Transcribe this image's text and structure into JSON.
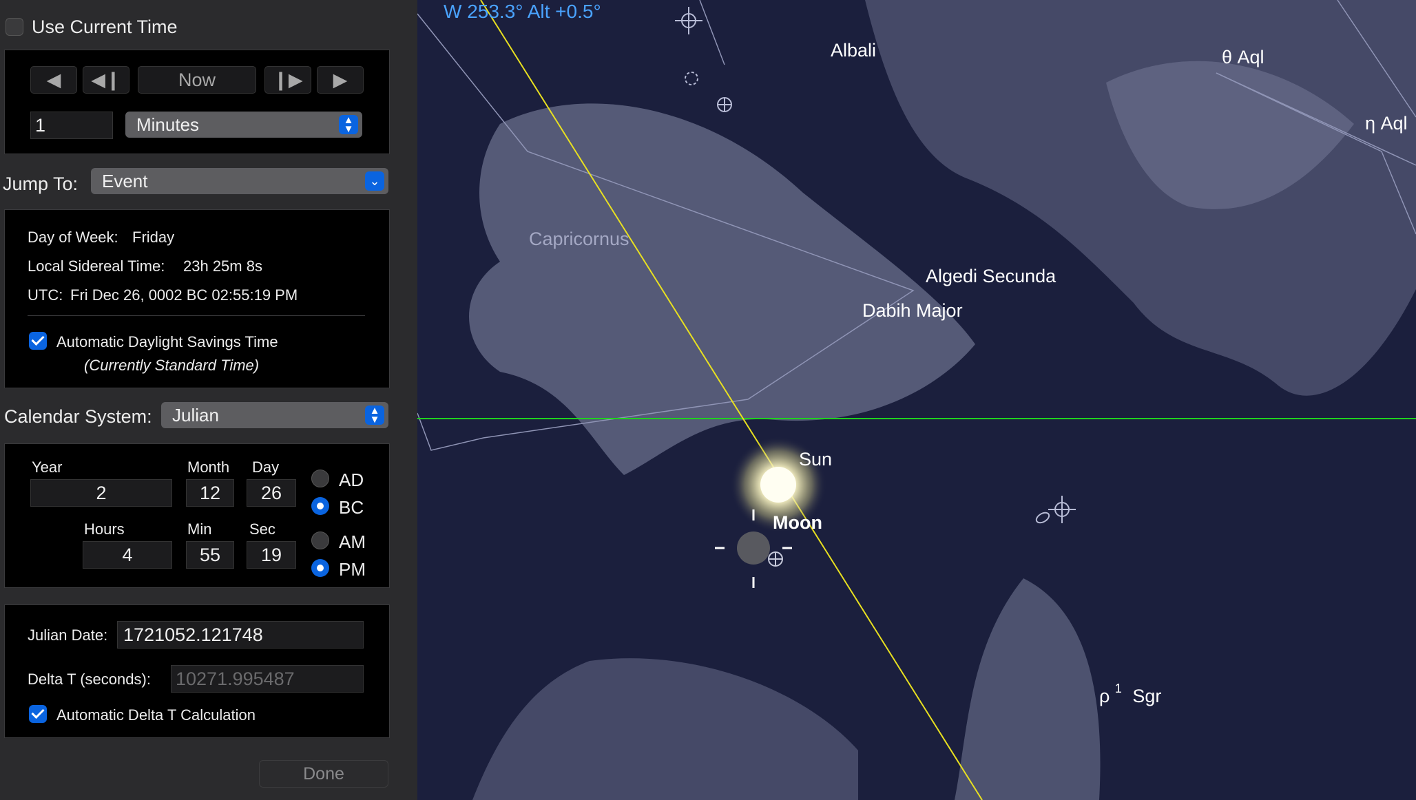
{
  "use_current_time": {
    "label": "Use Current Time",
    "checked": false
  },
  "step_controls": {
    "now_label": "Now",
    "step_value": "1",
    "step_unit": "Minutes"
  },
  "jump_to": {
    "label": "Jump To:",
    "value": "Event"
  },
  "info": {
    "day_of_week_label": "Day of Week:",
    "day_of_week": "Friday",
    "sidereal_label": "Local Sidereal Time:",
    "sidereal": "23h 25m 8s",
    "utc_label": "UTC:",
    "utc": "Fri Dec 26, 0002 BC 02:55:19 PM",
    "dst_label": "Automatic Daylight Savings Time",
    "dst_checked": true,
    "dst_note": "(Currently Standard Time)"
  },
  "calendar": {
    "label": "Calendar System:",
    "value": "Julian"
  },
  "date_fields": {
    "year_label": "Year",
    "year": "2",
    "month_label": "Month",
    "month": "12",
    "day_label": "Day",
    "day": "26",
    "hours_label": "Hours",
    "hours": "4",
    "min_label": "Min",
    "min": "55",
    "sec_label": "Sec",
    "sec": "19",
    "ad_label": "AD",
    "bc_label": "BC",
    "era_selected": "BC",
    "am_label": "AM",
    "pm_label": "PM",
    "ampm_selected": "PM"
  },
  "julian": {
    "jd_label": "Julian Date:",
    "jd": "1721052.121748",
    "delta_label": "Delta T (seconds):",
    "delta": "10271.995487",
    "auto_delta_label": "Automatic Delta T Calculation",
    "auto_delta_checked": true
  },
  "done_label": "Done",
  "sky": {
    "readout": "W 253.3° Alt +0.5°",
    "constellation": "Capricornus",
    "labels": {
      "albali": "Albali",
      "theta_aql": "θ Aql",
      "eta_aql": "η Aql",
      "algedi": "Algedi Secunda",
      "dabih": "Dabih Major",
      "sun": "Sun",
      "moon": "Moon",
      "rho_sgr_greek": "ρ",
      "rho_sgr_sup": "1",
      "rho_sgr_name": "Sgr"
    },
    "colors": {
      "background": "#1b1f3d",
      "horizon": "#1fd11f",
      "ecliptic": "#e8e020",
      "readout": "#4aa3ff"
    }
  }
}
